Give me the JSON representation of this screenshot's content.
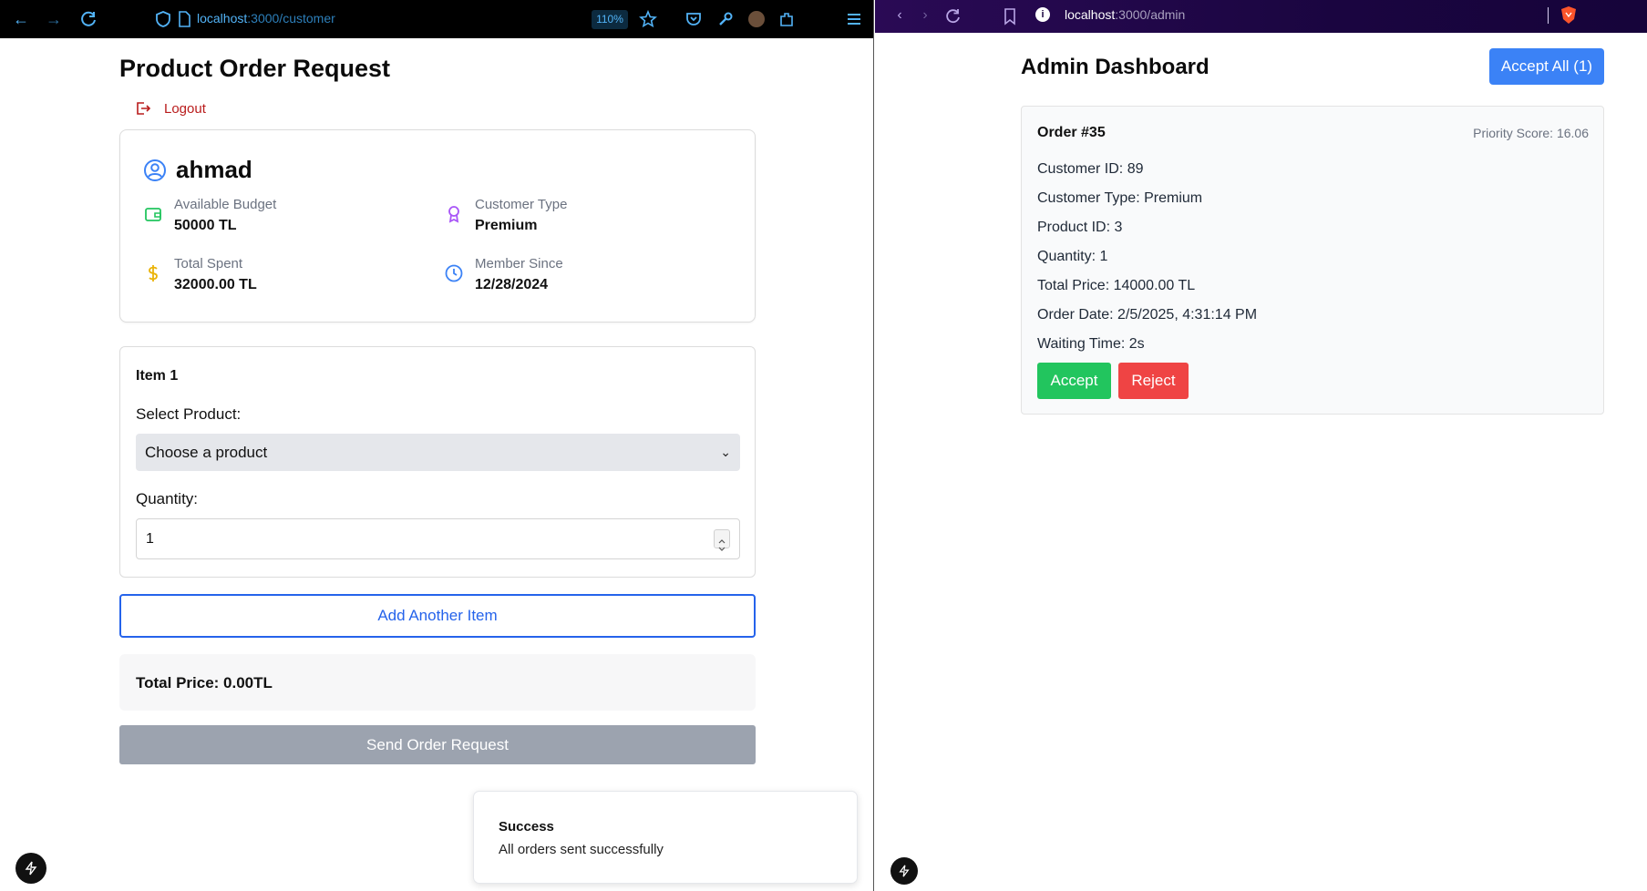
{
  "left_window": {
    "url_host": "localhost",
    "url_path": ":3000/customer",
    "zoom": "110%"
  },
  "customer_page": {
    "title": "Product Order Request",
    "logout_label": "Logout",
    "profile": {
      "name": "ahmad",
      "available_budget_label": "Available Budget",
      "available_budget_value": "50000 TL",
      "customer_type_label": "Customer Type",
      "customer_type_value": "Premium",
      "total_spent_label": "Total Spent",
      "total_spent_value": "32000.00 TL",
      "member_since_label": "Member Since",
      "member_since_value": "12/28/2024"
    },
    "item": {
      "title": "Item 1",
      "select_label": "Select Product:",
      "select_value": "Choose a product",
      "quantity_label": "Quantity:",
      "quantity_value": "1"
    },
    "add_item_label": "Add Another Item",
    "total_price": "Total Price: 0.00TL",
    "send_label": "Send Order Request",
    "toast": {
      "title": "Success",
      "message": "All orders sent successfully"
    }
  },
  "right_window": {
    "url_host": "localhost",
    "url_path": ":3000/admin"
  },
  "admin_page": {
    "title": "Admin Dashboard",
    "accept_all_label": "Accept All (1)",
    "order": {
      "title": "Order #35",
      "priority": "Priority Score: 16.06",
      "customer_id": "Customer ID: 89",
      "customer_type": "Customer Type: Premium",
      "product_id": "Product ID: 3",
      "quantity": "Quantity: 1",
      "total_price": "Total Price: 14000.00 TL",
      "order_date": "Order Date: 2/5/2025, 4:31:14 PM",
      "waiting_time": "Waiting Time: 2s",
      "accept_label": "Accept",
      "reject_label": "Reject"
    }
  },
  "colors": {
    "primary_blue": "#3b82f6",
    "link_blue": "#2563eb",
    "success_green": "#22c55e",
    "danger_red": "#ef4444",
    "logout_red": "#b91c1c",
    "disabled_gray": "#9ca3af"
  }
}
